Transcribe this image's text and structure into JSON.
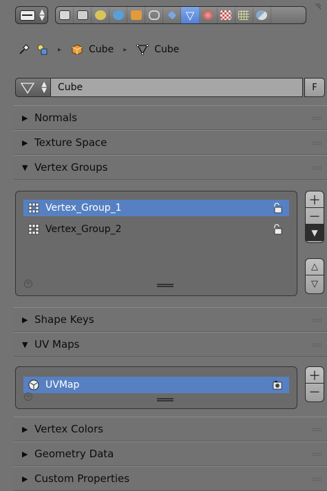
{
  "header": {
    "editor_icon": "properties-editor-icon",
    "tabs": [
      {
        "icon": "render-icon",
        "color": "#d8d8d8"
      },
      {
        "icon": "render-layers-icon",
        "color": "#d8d8d8"
      },
      {
        "icon": "scene-icon",
        "color": "#d8c55a"
      },
      {
        "icon": "world-icon",
        "color": "#5aa0d8"
      },
      {
        "icon": "object-icon",
        "color": "#e39a3a"
      },
      {
        "icon": "constraints-icon",
        "color": "#c9c9c9"
      },
      {
        "icon": "modifiers-icon",
        "color": "#7aa7e0"
      },
      {
        "icon": "mesh-data-icon",
        "color": "#ffffff",
        "active": true
      },
      {
        "icon": "material-icon",
        "color": "#d77"
      },
      {
        "icon": "texture-icon",
        "color": "#c55"
      },
      {
        "icon": "particles-icon",
        "color": "#dd9"
      },
      {
        "icon": "physics-icon",
        "color": "#8ac"
      }
    ]
  },
  "breadcrumb": {
    "pin_icon": "pin-icon",
    "scene_icon": "scene-icon",
    "object_label": "Cube",
    "mesh_label": "Cube"
  },
  "datablock": {
    "name": "Cube",
    "fake_user": "F"
  },
  "panels": {
    "normals": {
      "label": "Normals",
      "expanded": false
    },
    "texture_space": {
      "label": "Texture Space",
      "expanded": false
    },
    "vertex_groups": {
      "label": "Vertex Groups",
      "expanded": true,
      "items": [
        {
          "name": "Vertex_Group_1",
          "selected": true
        },
        {
          "name": "Vertex_Group_2",
          "selected": false
        }
      ]
    },
    "shape_keys": {
      "label": "Shape Keys",
      "expanded": false
    },
    "uv_maps": {
      "label": "UV Maps",
      "expanded": true,
      "items": [
        {
          "name": "UVMap",
          "selected": true
        }
      ]
    },
    "vertex_colors": {
      "label": "Vertex Colors",
      "expanded": false
    },
    "geometry_data": {
      "label": "Geometry Data",
      "expanded": false
    },
    "custom_properties": {
      "label": "Custom Properties",
      "expanded": false
    }
  },
  "colors": {
    "background": "#737373",
    "selected_row": "#5680c2",
    "active_tab": "#5681d6"
  }
}
